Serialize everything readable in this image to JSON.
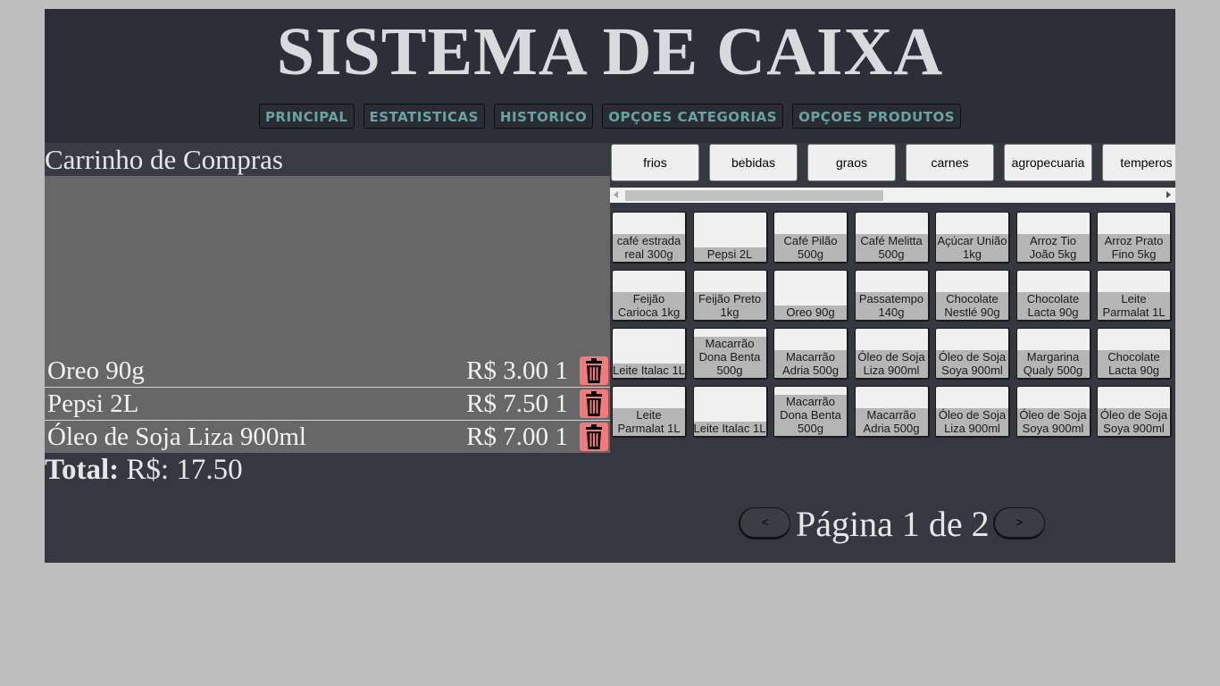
{
  "app": {
    "title": "SISTEMA DE CAIXA"
  },
  "nav": [
    "PRINCIPAL",
    "ESTATISTICAS",
    "HISTORICO",
    "OPÇOES CATEGORIAS",
    "OPÇOES PRODUTOS"
  ],
  "cart": {
    "title": "Carrinho de Compras",
    "items": [
      {
        "name": "Oreo 90g",
        "price": "R$ 3.00",
        "qty": "1"
      },
      {
        "name": "Pepsi 2L",
        "price": "R$ 7.50",
        "qty": "1"
      },
      {
        "name": "Óleo de Soja Liza 900ml",
        "price": "R$ 7.00",
        "qty": "1"
      }
    ],
    "total_label": "Total:",
    "total_value": " R$: 17.50"
  },
  "categories": [
    "frios",
    "bebidas",
    "graos",
    "carnes",
    "agropecuaria",
    "temperos"
  ],
  "products": [
    "café estrada real 300g",
    "Pepsi 2L",
    "Café Pilão 500g",
    "Café Melitta 500g",
    "Açúcar União 1kg",
    "Arroz Tio João 5kg",
    "Arroz Prato Fino 5kg",
    "Feijão Carioca 1kg",
    "Feijão Preto 1kg",
    "Oreo 90g",
    "Passatempo 140g",
    "Chocolate Nestlé 90g",
    "Chocolate Lacta 90g",
    "Leite Parmalat 1L",
    "Leite Italac 1L",
    "Macarrão Dona Benta 500g",
    "Macarrão Adria 500g",
    "Óleo de Soja Liza 900ml",
    "Óleo de Soja Soya 900ml",
    "Margarina Qualy 500g",
    "Chocolate Lacta 90g",
    "Leite Parmalat 1L",
    "Leite Italac 1L",
    "Macarrão Dona Benta 500g",
    "Macarrão Adria 500g",
    "Óleo de Soja Liza 900ml",
    "Óleo de Soja Soya 900ml",
    "Óleo de Soja Soya 900ml"
  ],
  "pager": {
    "prev": "<",
    "next": ">",
    "text": "Página 1 de 2"
  },
  "colors": {
    "header_bg": "#2c2f38",
    "panel_bg": "#353841",
    "nav_text": "#68a3a3",
    "trash": "#f27a7a"
  }
}
